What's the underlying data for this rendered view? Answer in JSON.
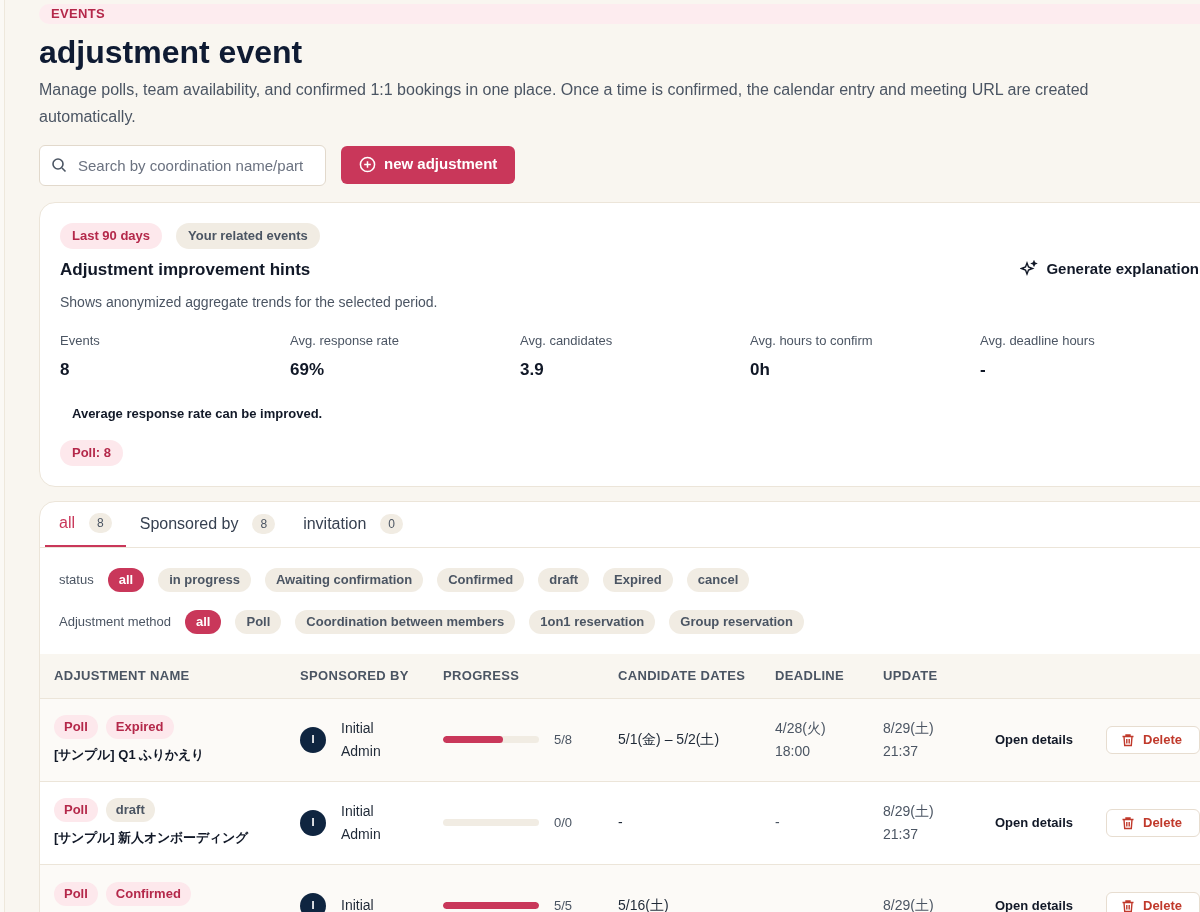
{
  "section_label": "EVENTS",
  "title": "adjustment event",
  "description": "Manage polls, team availability, and confirmed 1:1 bookings in one place. Once a time is confirmed, the calendar entry and meeting URL are created automatically.",
  "search": {
    "placeholder": "Search by coordination name/part"
  },
  "new_button": "new adjustment",
  "hints": {
    "chips": [
      {
        "label": "Last 90 days",
        "kind": "accent"
      },
      {
        "label": "Your related events",
        "kind": "neutral"
      }
    ],
    "title": "Adjustment improvement hints",
    "action": "Generate explanation",
    "subtitle": "Shows anonymized aggregate trends for the selected period.",
    "stats": [
      {
        "label": "Events",
        "value": "8"
      },
      {
        "label": "Avg. response rate",
        "value": "69%"
      },
      {
        "label": "Avg. candidates",
        "value": "3.9"
      },
      {
        "label": "Avg. hours to confirm",
        "value": "0h"
      },
      {
        "label": "Avg. deadline hours",
        "value": "-"
      }
    ],
    "message": "Average response rate can be improved.",
    "badges": [
      {
        "label": "Poll: 8",
        "kind": "accent"
      }
    ]
  },
  "tabs": [
    {
      "label": "all",
      "count": "8",
      "selected": true
    },
    {
      "label": "Sponsored by",
      "count": "8",
      "selected": false
    },
    {
      "label": "invitation",
      "count": "0",
      "selected": false
    }
  ],
  "filters": [
    {
      "label": "status",
      "options": [
        {
          "label": "all",
          "selected": true
        },
        {
          "label": "in progress",
          "selected": false
        },
        {
          "label": "Awaiting confirmation",
          "selected": false
        },
        {
          "label": "Confirmed",
          "selected": false
        },
        {
          "label": "draft",
          "selected": false
        },
        {
          "label": "Expired",
          "selected": false
        },
        {
          "label": "cancel",
          "selected": false
        }
      ]
    },
    {
      "label": "Adjustment method",
      "options": [
        {
          "label": "all",
          "selected": true
        },
        {
          "label": "Poll",
          "selected": false
        },
        {
          "label": "Coordination between members",
          "selected": false
        },
        {
          "label": "1on1 reservation",
          "selected": false
        },
        {
          "label": "Group reservation",
          "selected": false
        }
      ]
    }
  ],
  "table": {
    "columns": [
      "ADJUSTMENT NAME",
      "SPONSORED BY",
      "PROGRESS",
      "CANDIDATE DATES",
      "DEADLINE",
      "UPDATE"
    ],
    "rows": [
      {
        "tags": [
          {
            "label": "Poll",
            "kind": "accent"
          },
          {
            "label": "Expired",
            "kind": "accent"
          }
        ],
        "name": "[サンプル] Q1 ふりかえり",
        "avatar": "I",
        "sponsor": [
          "Initial",
          "Admin"
        ],
        "level": 0.625,
        "progress": "5/8",
        "dates": "5/1(金) – 5/2(土)",
        "deadline": [
          "4/28(火)",
          "18:00"
        ],
        "update": [
          "8/29(土)",
          "21:37"
        ],
        "open": "Open details",
        "delete": "Delete"
      },
      {
        "tags": [
          {
            "label": "Poll",
            "kind": "accent"
          },
          {
            "label": "draft",
            "kind": "neutral"
          }
        ],
        "name": "[サンプル] 新人オンボーディング",
        "avatar": "I",
        "sponsor": [
          "Initial",
          "Admin"
        ],
        "level": 0,
        "progress": "0/0",
        "dates": "-",
        "deadline": [
          "-"
        ],
        "update": [
          "8/29(土)",
          "21:37"
        ],
        "open": "Open details",
        "delete": "Delete"
      },
      {
        "tags": [
          {
            "label": "Poll",
            "kind": "accent"
          },
          {
            "label": "Confirmed",
            "kind": "accent"
          }
        ],
        "avatar": "I",
        "sponsor": [
          "Initial"
        ],
        "level": 1,
        "progress": "5/5",
        "dates": "5/16(土)",
        "deadline": [],
        "update": [
          "8/29(土)"
        ],
        "open": "Open details",
        "delete": "Delete"
      }
    ]
  }
}
